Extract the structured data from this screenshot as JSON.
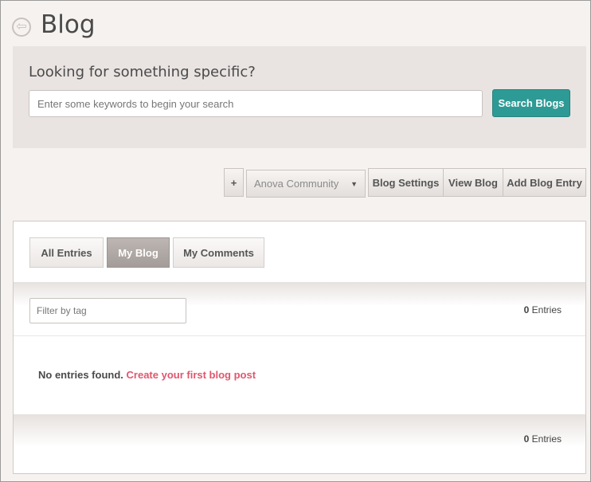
{
  "header": {
    "title": "Blog",
    "back_icon_glyph": "⇦"
  },
  "search": {
    "heading": "Looking for something specific?",
    "placeholder": "Enter some keywords to begin your search",
    "value": "",
    "button_label": "Search Blogs"
  },
  "actions": {
    "plus_label": "+",
    "community_select": "Anova Community",
    "blog_settings": "Blog Settings",
    "view_blog": "View Blog",
    "add_blog_entry": "Add Blog Entry"
  },
  "tabs": [
    {
      "label": "All Entries",
      "active": false
    },
    {
      "label": "My Blog",
      "active": true
    },
    {
      "label": "My Comments",
      "active": false
    }
  ],
  "filter": {
    "placeholder": "Filter by tag",
    "value": ""
  },
  "entries": {
    "count": "0",
    "label": "Entries"
  },
  "empty_state": {
    "message": "No entries found.",
    "link_text": "Create your first blog post"
  },
  "colors": {
    "accent": "#2e9a95",
    "link": "#e0566d"
  }
}
